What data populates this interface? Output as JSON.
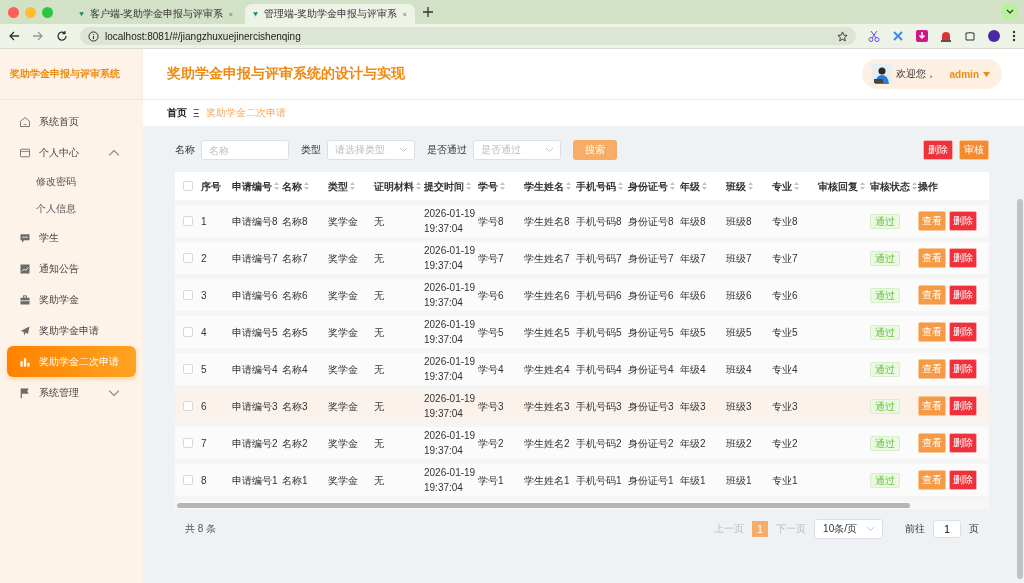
{
  "browser": {
    "tabs": [
      {
        "title": "客户端-奖助学金申报与评审系",
        "selected": false
      },
      {
        "title": "管理端-奖助学金申报与评审系",
        "selected": true
      }
    ],
    "url": "localhost:8081/#/jiangzhuxuejinercishenqing"
  },
  "sidebar": {
    "title": "奖助学金申报与评审系统",
    "items": [
      {
        "label": "系统首页",
        "kind": "home",
        "selected": false
      },
      {
        "label": "个人中心",
        "kind": "wallet",
        "selected": false,
        "expanded": true,
        "children": [
          {
            "label": "修改密码"
          },
          {
            "label": "个人信息"
          }
        ]
      },
      {
        "label": "学生",
        "kind": "chat",
        "selected": false
      },
      {
        "label": "通知公告",
        "kind": "chart",
        "selected": false
      },
      {
        "label": "奖助学金",
        "kind": "case",
        "selected": false
      },
      {
        "label": "奖助学金申请",
        "kind": "plane",
        "selected": false
      },
      {
        "label": "奖助学金二次申请",
        "kind": "bars",
        "selected": true
      },
      {
        "label": "系统管理",
        "kind": "flag",
        "selected": false,
        "expanded": false
      }
    ]
  },
  "header": {
    "title": "奖助学金申报与评审系统的设计与实现",
    "welcome": "欢迎您，",
    "user": "admin"
  },
  "breadcrumb": {
    "home": "首页",
    "separator": "Ξ",
    "current": "奖助学金二次申请"
  },
  "filters": [
    {
      "label": "名称",
      "placeholder": "名称",
      "kind": "input"
    },
    {
      "label": "类型",
      "placeholder": "请选择类型",
      "kind": "select"
    },
    {
      "label": "是否通过",
      "placeholder": "是否通过",
      "kind": "select"
    }
  ],
  "search_button": "搜索",
  "toolbar": [
    {
      "label": "删除",
      "kind": "danger"
    },
    {
      "label": "审核",
      "kind": "warning"
    }
  ],
  "table": {
    "all_checked": false,
    "columns": [
      {
        "label": "序号",
        "sortable": false
      },
      {
        "label": "申请编号",
        "sortable": true
      },
      {
        "label": "名称",
        "sortable": true
      },
      {
        "label": "类型",
        "sortable": true
      },
      {
        "label": "证明材料",
        "sortable": true
      },
      {
        "label": "提交时间",
        "sortable": true
      },
      {
        "label": "学号",
        "sortable": true
      },
      {
        "label": "学生姓名",
        "sortable": true
      },
      {
        "label": "手机号码",
        "sortable": true
      },
      {
        "label": "身份证号",
        "sortable": true
      },
      {
        "label": "年级",
        "sortable": true
      },
      {
        "label": "班级",
        "sortable": true
      },
      {
        "label": "专业",
        "sortable": true
      },
      {
        "label": "审核回复",
        "sortable": true
      },
      {
        "label": "审核状态",
        "sortable": true
      },
      {
        "label": "操作",
        "sortable": false
      }
    ],
    "rows": [
      {
        "checked": false,
        "highlighted": false,
        "cells": [
          "1",
          "申请编号8",
          "名称8",
          "奖学金",
          "无",
          "2026-01-19 19:37:04",
          "学号8",
          "学生姓名8",
          "手机号码8",
          "身份证号8",
          "年级8",
          "班级8",
          "专业8"
        ],
        "status": "通过",
        "actions": [
          "查看",
          "删除"
        ]
      },
      {
        "checked": false,
        "highlighted": false,
        "cells": [
          "2",
          "申请编号7",
          "名称7",
          "奖学金",
          "无",
          "2026-01-19 19:37:04",
          "学号7",
          "学生姓名7",
          "手机号码7",
          "身份证号7",
          "年级7",
          "班级7",
          "专业7"
        ],
        "status": "通过",
        "actions": [
          "查看",
          "删除"
        ]
      },
      {
        "checked": false,
        "highlighted": false,
        "cells": [
          "3",
          "申请编号6",
          "名称6",
          "奖学金",
          "无",
          "2026-01-19 19:37:04",
          "学号6",
          "学生姓名6",
          "手机号码6",
          "身份证号6",
          "年级6",
          "班级6",
          "专业6"
        ],
        "status": "通过",
        "actions": [
          "查看",
          "删除"
        ]
      },
      {
        "checked": false,
        "highlighted": false,
        "cells": [
          "4",
          "申请编号5",
          "名称5",
          "奖学金",
          "无",
          "2026-01-19 19:37:04",
          "学号5",
          "学生姓名5",
          "手机号码5",
          "身份证号5",
          "年级5",
          "班级5",
          "专业5"
        ],
        "status": "通过",
        "actions": [
          "查看",
          "删除"
        ]
      },
      {
        "checked": false,
        "highlighted": false,
        "cells": [
          "5",
          "申请编号4",
          "名称4",
          "奖学金",
          "无",
          "2026-01-19 19:37:04",
          "学号4",
          "学生姓名4",
          "手机号码4",
          "身份证号4",
          "年级4",
          "班级4",
          "专业4"
        ],
        "status": "通过",
        "actions": [
          "查看",
          "删除"
        ]
      },
      {
        "checked": false,
        "highlighted": true,
        "cells": [
          "6",
          "申请编号3",
          "名称3",
          "奖学金",
          "无",
          "2026-01-19 19:37:04",
          "学号3",
          "学生姓名3",
          "手机号码3",
          "身份证号3",
          "年级3",
          "班级3",
          "专业3"
        ],
        "status": "通过",
        "actions": [
          "查看",
          "删除"
        ]
      },
      {
        "checked": false,
        "highlighted": false,
        "cells": [
          "7",
          "申请编号2",
          "名称2",
          "奖学金",
          "无",
          "2026-01-19 19:37:04",
          "学号2",
          "学生姓名2",
          "手机号码2",
          "身份证号2",
          "年级2",
          "班级2",
          "专业2"
        ],
        "status": "通过",
        "actions": [
          "查看",
          "删除"
        ]
      },
      {
        "checked": false,
        "highlighted": false,
        "cells": [
          "8",
          "申请编号1",
          "名称1",
          "奖学金",
          "无",
          "2026-01-19 19:37:04",
          "学号1",
          "学生姓名1",
          "手机号码1",
          "身份证号1",
          "年级1",
          "班级1",
          "专业1"
        ],
        "status": "通过",
        "actions": [
          "查看",
          "删除"
        ]
      }
    ]
  },
  "pagination": {
    "total": "共 8 条",
    "prev": "上一页",
    "pages": [
      {
        "label": "1",
        "selected": true
      }
    ],
    "next": "下一页",
    "page_size": "10条/页",
    "goto_label": "前往",
    "goto_value": "1",
    "goto_suffix": "页"
  }
}
